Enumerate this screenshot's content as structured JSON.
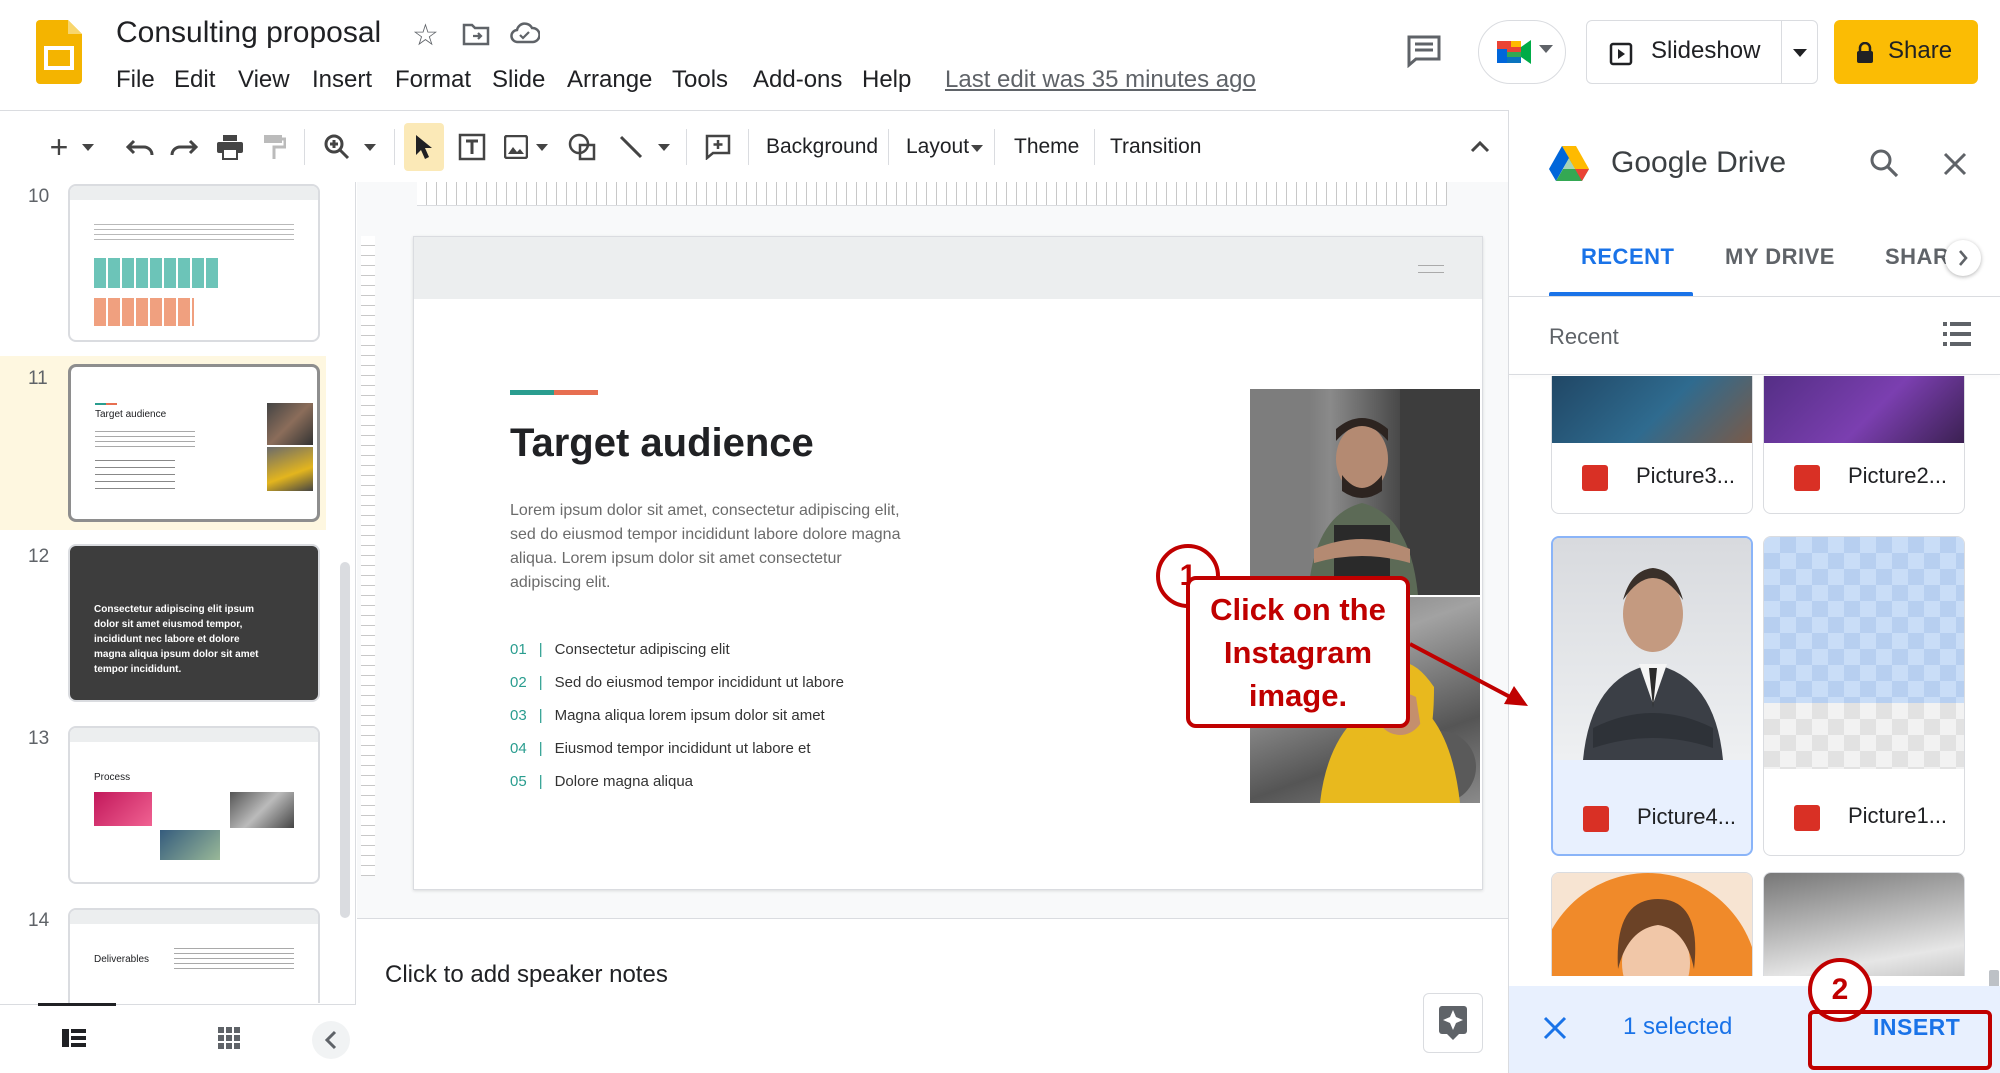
{
  "app": {
    "doc_title": "Consulting proposal",
    "last_edit": "Last edit was 35 minutes ago",
    "menu": [
      "File",
      "Edit",
      "View",
      "Insert",
      "Format",
      "Slide",
      "Arrange",
      "Tools",
      "Add-ons",
      "Help"
    ],
    "slideshow_label": "Slideshow",
    "share_label": "Share"
  },
  "toolbar": {
    "background_label": "Background",
    "layout_label": "Layout",
    "theme_label": "Theme",
    "transition_label": "Transition"
  },
  "filmstrip": {
    "slides": [
      {
        "number": "10"
      },
      {
        "number": "11",
        "title": "Target audience"
      },
      {
        "number": "12",
        "title": "Consectetur adipiscing elit ipsum dolor sit amet eiusmod tempor, incididunt nec labore et dolore magna aliqua ipsum dolor sit amet tempor incididunt."
      },
      {
        "number": "13",
        "title": "Process"
      },
      {
        "number": "14",
        "title": "Deliverables"
      }
    ]
  },
  "slide": {
    "title": "Target audience",
    "body": "Lorem ipsum dolor sit amet, consectetur adipiscing elit, sed do eiusmod tempor incididunt labore dolore magna aliqua. Lorem ipsum dolor sit amet consectetur adipiscing elit.",
    "list": [
      {
        "num": "01",
        "text": "Consectetur adipiscing elit"
      },
      {
        "num": "02",
        "text": "Sed do eiusmod tempor incididunt ut labore"
      },
      {
        "num": "03",
        "text": "Magna aliqua lorem ipsum dolor sit amet"
      },
      {
        "num": "04",
        "text": "Eiusmod tempor incididunt ut labore et"
      },
      {
        "num": "05",
        "text": "Dolore magna aliqua"
      }
    ],
    "accent_colors": [
      "#2a9d8f",
      "#e76f51"
    ]
  },
  "notes": {
    "placeholder": "Click to add speaker notes"
  },
  "drive": {
    "title": "Google Drive",
    "tabs": [
      "RECENT",
      "MY DRIVE",
      "SHAR"
    ],
    "section_label": "Recent",
    "files": [
      {
        "name": "Picture3..."
      },
      {
        "name": "Picture2..."
      },
      {
        "name": "Picture4..."
      },
      {
        "name": "Picture1..."
      }
    ],
    "selected_text": "1 selected",
    "insert_label": "INSERT",
    "accent": "#1a73e8"
  },
  "annotations": {
    "step1_number": "1",
    "step1_text": "Click on the Instagram image.",
    "step2_number": "2",
    "color": "#c00000"
  }
}
